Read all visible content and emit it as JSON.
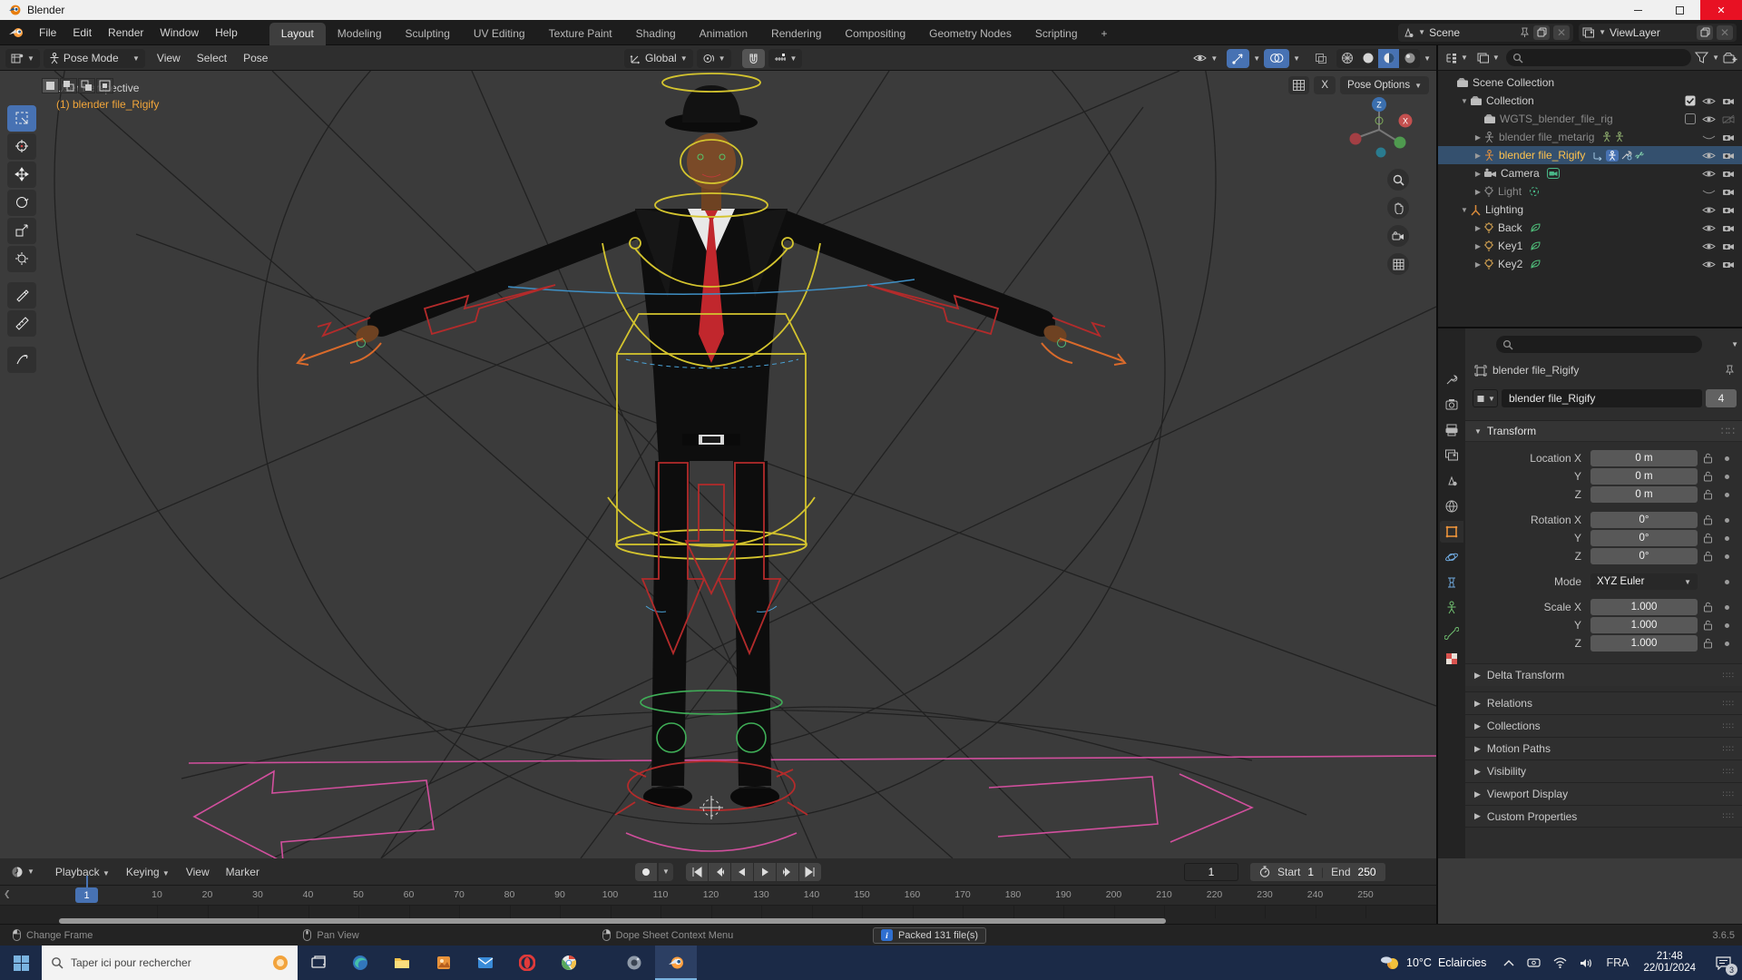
{
  "window": {
    "title": "Blender"
  },
  "topbar": {
    "menus": [
      "File",
      "Edit",
      "Render",
      "Window",
      "Help"
    ],
    "tabs": [
      "Layout",
      "Modeling",
      "Sculpting",
      "UV Editing",
      "Texture Paint",
      "Shading",
      "Animation",
      "Rendering",
      "Compositing",
      "Geometry Nodes",
      "Scripting"
    ],
    "active_tab": "Layout",
    "add_tab": "+",
    "scene": "Scene",
    "view_layer": "ViewLayer"
  },
  "tool_header": {
    "mode": "Pose Mode",
    "menus": [
      "View",
      "Select",
      "Pose"
    ],
    "orientation": "Global"
  },
  "viewport": {
    "view_label": "User Perspective",
    "object_label": "(1) blender file_Rigify",
    "pose_options": "Pose Options",
    "close_label": "X"
  },
  "outliner": {
    "items": [
      {
        "label": "Scene Collection",
        "depth": 0,
        "icon": "collection",
        "disclosure": "",
        "toggles": []
      },
      {
        "label": "Collection",
        "depth": 1,
        "icon": "collection",
        "disclosure": "down",
        "toggles": [
          "check",
          "eye",
          "cam"
        ]
      },
      {
        "label": "WGTS_blender_file_rig",
        "depth": 2,
        "icon": "collection",
        "gray": true,
        "disclosure": "",
        "toggles": [
          "uncheck",
          "eye",
          "camoff"
        ]
      },
      {
        "label": "blender file_metarig",
        "depth": 2,
        "icon": "armature",
        "gray": true,
        "disclosure": "right",
        "badges": [
          "pose",
          "pose"
        ],
        "toggles": [
          "eyeclosed",
          "cam"
        ]
      },
      {
        "label": "blender file_Rigify",
        "depth": 2,
        "icon": "armatureActive",
        "selected": true,
        "disclosure": "right",
        "badges": [
          "anim",
          "armhl",
          "tools",
          "bone"
        ],
        "toggles": [
          "eye",
          "cam"
        ]
      },
      {
        "label": "Camera",
        "depth": 2,
        "icon": "cameraObj",
        "disclosure": "right",
        "badges": [
          "camdata"
        ],
        "toggles": [
          "eye",
          "cam"
        ]
      },
      {
        "label": "Light",
        "depth": 2,
        "icon": "lightGray",
        "gray": true,
        "disclosure": "right",
        "badges": [
          "lightdata"
        ],
        "toggles": [
          "eyeclosed",
          "cam"
        ]
      },
      {
        "label": "Lighting",
        "depth": 1,
        "icon": "axes",
        "disclosure": "down",
        "toggles": [
          "eye",
          "cam"
        ]
      },
      {
        "label": "Back",
        "depth": 2,
        "icon": "light",
        "disclosure": "right",
        "badges": [
          "nodetree"
        ],
        "toggles": [
          "eye",
          "cam"
        ]
      },
      {
        "label": "Key1",
        "depth": 2,
        "icon": "light",
        "disclosure": "right",
        "badges": [
          "nodetree"
        ],
        "toggles": [
          "eye",
          "cam"
        ]
      },
      {
        "label": "Key2",
        "depth": 2,
        "icon": "light",
        "disclosure": "right",
        "badges": [
          "nodetree"
        ],
        "toggles": [
          "eye",
          "cam"
        ]
      }
    ]
  },
  "properties": {
    "breadcrumb": "blender file_Rigify",
    "name": "blender file_Rigify",
    "users": "4",
    "transform_title": "Transform",
    "transform_rows": [
      {
        "label": "Location X",
        "value": "0 m"
      },
      {
        "label": "Y",
        "value": "0 m"
      },
      {
        "label": "Z",
        "value": "0 m"
      },
      {
        "label": "Rotation X",
        "value": "0°",
        "gap": true
      },
      {
        "label": "Y",
        "value": "0°"
      },
      {
        "label": "Z",
        "value": "0°"
      },
      {
        "label": "Mode",
        "value": "XYZ Euler",
        "type": "dropdown",
        "gap": true
      },
      {
        "label": "Scale X",
        "value": "1.000",
        "gap": true
      },
      {
        "label": "Y",
        "value": "1.000"
      },
      {
        "label": "Z",
        "value": "1.000"
      }
    ],
    "sections": [
      "Delta Transform",
      "Relations",
      "Collections",
      "Motion Paths",
      "Visibility",
      "Viewport Display",
      "Custom Properties"
    ]
  },
  "timeline": {
    "menus": [
      "Playback",
      "Keying",
      "View",
      "Marker"
    ],
    "current_frame": "1",
    "start_label": "Start",
    "start_value": "1",
    "end_label": "End",
    "end_value": "250",
    "ticks": [
      10,
      20,
      30,
      40,
      50,
      60,
      70,
      80,
      90,
      100,
      110,
      120,
      130,
      140,
      150,
      160,
      170,
      180,
      190,
      200,
      210,
      220,
      230,
      240,
      250
    ]
  },
  "statusbar": {
    "items": [
      "Change Frame",
      "Pan View",
      "Dope Sheet Context Menu"
    ],
    "packed": "Packed 131 file(s)",
    "version": "3.6.5"
  },
  "taskbar": {
    "search_placeholder": "Taper ici pour rechercher",
    "weather_temp": "10°C",
    "weather_desc": "Eclaircies",
    "language": "FRA",
    "time": "21:48",
    "date": "22/01/2024",
    "notification_count": "3"
  }
}
